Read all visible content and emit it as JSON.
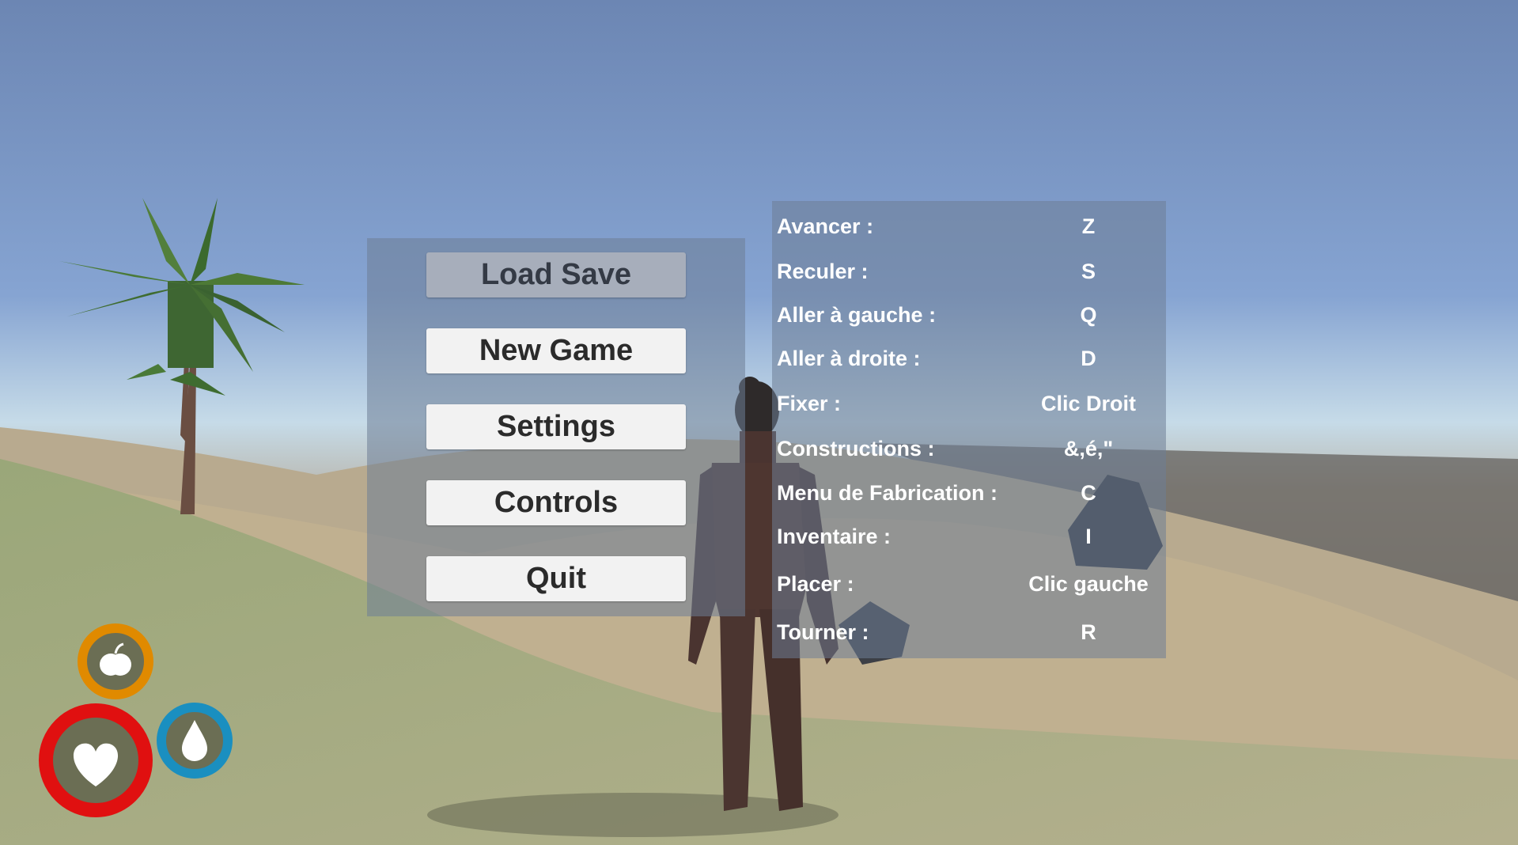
{
  "menu": {
    "buttons": [
      {
        "label": "Load Save",
        "enabled": false
      },
      {
        "label": "New Game",
        "enabled": true
      },
      {
        "label": "Settings",
        "enabled": true
      },
      {
        "label": "Controls",
        "enabled": true
      },
      {
        "label": "Quit",
        "enabled": true
      }
    ]
  },
  "controls": [
    {
      "action": "Avancer :",
      "key": "Z"
    },
    {
      "action": "Reculer :",
      "key": "S"
    },
    {
      "action": "Aller à gauche :",
      "key": "Q"
    },
    {
      "action": "Aller à droite :",
      "key": "D"
    },
    {
      "action": "Fixer :",
      "key": "Clic Droit"
    },
    {
      "action": "Constructions :",
      "key": "&,é,\""
    },
    {
      "action": "Menu de Fabrication :",
      "key": "C"
    },
    {
      "action": "Inventaire :",
      "key": "I"
    },
    {
      "action": "Placer :",
      "key": "Clic gauche"
    },
    {
      "action": "Tourner :",
      "key": "R"
    }
  ],
  "hud": {
    "hunger": {
      "icon": "apple-icon",
      "color": "#e08a00"
    },
    "health": {
      "icon": "heart-icon",
      "color": "#e01010"
    },
    "thirst": {
      "icon": "water-drop-icon",
      "color": "#1a8fc0"
    }
  },
  "colors": {
    "button_bg": "#f2f2f2",
    "button_disabled_bg": "#a7aebb",
    "panel_bg": "rgba(110,125,150,0.55)"
  }
}
